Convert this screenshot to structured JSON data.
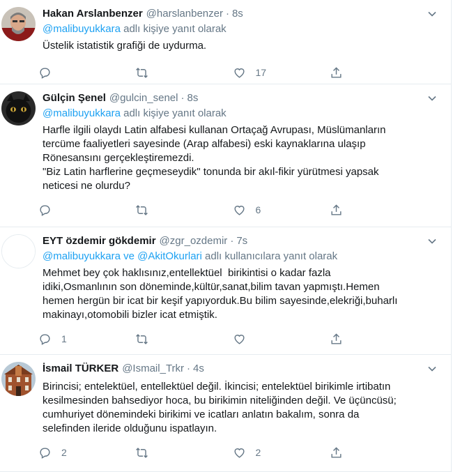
{
  "tweets": [
    {
      "name": "Hakan Arslanbenzer",
      "handle": "@harslanbenzer",
      "time": "8s",
      "reply_user1": "@malibuyukkara",
      "reply_sep": "",
      "reply_user2": "",
      "reply_suffix": " adlı kişiye yanıt olarak",
      "text": "Üstelik istatistik grafiği de uydurma.",
      "replies": "",
      "retweets": "",
      "likes": "17"
    },
    {
      "name": "Gülçin Şenel",
      "handle": "@gulcin_senel",
      "time": "8s",
      "reply_user1": "@malibuyukkara",
      "reply_sep": "",
      "reply_user2": "",
      "reply_suffix": " adlı kişiye yanıt olarak",
      "text": "Harfle ilgili olaydı Latin alfabesi kullanan Ortaçağ Avrupası, Müslümanların\ntercüme faaliyetleri sayesinde (Arap alfabesi) eski kaynaklarına ulaşıp\nRönesansını gerçekleştiremezdi.\n\"Biz Latin harflerine geçmeseydik\" tonunda bir akıl-fikir yürütmesi yapsak\nneticesi ne olurdu?",
      "replies": "",
      "retweets": "",
      "likes": "6"
    },
    {
      "name": "EYT özdemir gökdemir",
      "handle": "@zgr_ozdemir",
      "time": "7s",
      "reply_user1": "@malibuyukkara",
      "reply_sep": " ve ",
      "reply_user2": "@AkitOkurlari",
      "reply_suffix": " adlı kullanıcılara yanıt olarak",
      "text": "Mehmet bey çok haklısınız,entellektüel  birikintisi o kadar fazla\nidiki,Osmanlının son döneminde,kültür,sanat,bilim tavan yapmıştı.Hemen\nhemen hergün bir icat bir keşif yapıyorduk.Bu bilim sayesinde,elekriği,buharlı\nmakinayı,otomobili bizler icat etmiştik.",
      "replies": "1",
      "retweets": "",
      "likes": ""
    },
    {
      "name": "İsmail TÜRKER",
      "handle": "@Ismail_Trkr",
      "time": "4s",
      "reply_user1": "",
      "reply_sep": "",
      "reply_user2": "",
      "reply_suffix": "",
      "text": "Birincisi; entelektüel, entellektüel değil. İkincisi; entelektüel birikimle irtibatın\nkesilmesinden bahsediyor hoca, bu birikimin niteliğinden değil. Ve üçüncüsü;\ncumhuriyet dönemindeki birikimi ve icatları anlatın bakalım, sonra da\nselefinden ileride olduğunu ispatlayın.",
      "replies": "2",
      "retweets": "",
      "likes": "2"
    }
  ],
  "icons": {
    "reply": "reply-icon",
    "retweet": "retweet-icon",
    "like": "heart-icon",
    "share": "share-icon",
    "more": "chevron-down-icon"
  },
  "colors": {
    "link": "#1da1f2",
    "secondary": "#657786",
    "text": "#14171a",
    "border": "#e6ecf0"
  }
}
